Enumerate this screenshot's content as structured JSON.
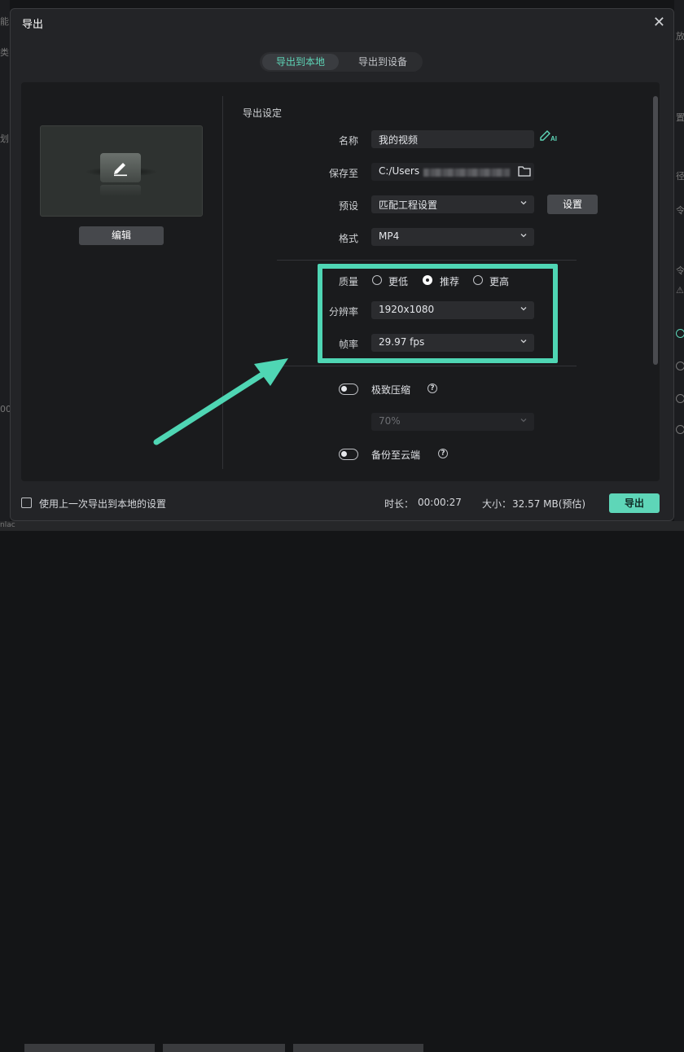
{
  "background": {
    "left_peek": [
      "能",
      "类",
      "划",
      "00",
      "nlac"
    ],
    "right_peek": [
      "放",
      "置",
      "径",
      "令",
      "令",
      "⚠"
    ]
  },
  "dialog": {
    "title": "导出",
    "close_icon": "close-icon"
  },
  "tabs": [
    {
      "label": "导出到本地",
      "active": true
    },
    {
      "label": "导出到设备",
      "active": false
    }
  ],
  "preview": {
    "edit_label": "编辑",
    "icon": "pencil-icon"
  },
  "settings": {
    "section_title": "导出设定",
    "name": {
      "label": "名称",
      "value": "我的视频"
    },
    "save_to": {
      "label": "保存至",
      "value": "C:/Users"
    },
    "preset": {
      "label": "预设",
      "value": "匹配工程设置",
      "button": "设置"
    },
    "format": {
      "label": "格式",
      "value": "MP4"
    },
    "quality": {
      "label": "质量",
      "options": [
        "更低",
        "推荐",
        "更高"
      ],
      "selected": "推荐"
    },
    "resolution": {
      "label": "分辨率",
      "value": "1920x1080"
    },
    "frame_rate": {
      "label": "帧率",
      "value": "29.97 fps"
    },
    "extreme_compress": {
      "label": "极致压缩",
      "value": "70%",
      "enabled": false
    },
    "cloud_backup": {
      "label": "备份至云端",
      "enabled": false
    }
  },
  "footer": {
    "use_last": "使用上一次导出到本地的设置",
    "duration_label": "时长：",
    "duration_value": "00:00:27",
    "size_label": "大小：",
    "size_value": "32.57 MB(预估)",
    "export_button": "导出"
  },
  "colors": {
    "accent": "#5ed6b8",
    "highlight": "#4fd6b4",
    "dialog_bg": "#232427",
    "panel_bg": "#1a1b1d"
  }
}
